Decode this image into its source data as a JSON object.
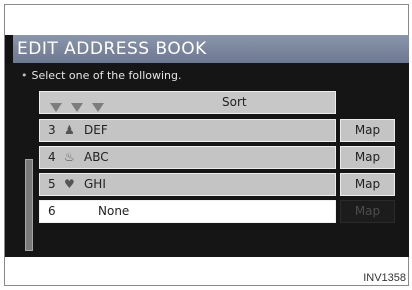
{
  "title": "EDIT ADDRESS BOOK",
  "instruction": "Select one of the following.",
  "instruction_bullet": "•",
  "sort_label": "Sort",
  "rows": [
    {
      "num": "3",
      "icon": "♟",
      "icon_name": "person-icon",
      "name": "DEF",
      "map": "Map",
      "map_enabled": true
    },
    {
      "num": "4",
      "icon": "♨",
      "icon_name": "car-icon",
      "name": "ABC",
      "map": "Map",
      "map_enabled": true
    },
    {
      "num": "5",
      "icon": "♥",
      "icon_name": "heart-icon",
      "name": "GHI",
      "map": "Map",
      "map_enabled": true
    },
    {
      "num": "6",
      "icon": "",
      "icon_name": "",
      "name": "None",
      "map": "Map",
      "map_enabled": false,
      "selected": true
    }
  ],
  "caption": "INV1358",
  "colors": {
    "title_bar": "#7b869d",
    "row_bg": "#c4c4c4",
    "selected_row_bg": "#ffffff",
    "screen_bg": "#151515"
  }
}
